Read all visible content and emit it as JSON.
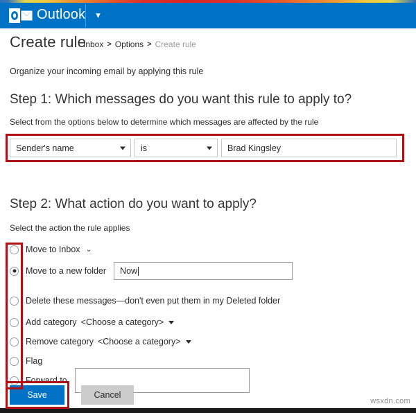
{
  "header": {
    "brand": "Outlook",
    "caret_icon": "chevron-down-icon"
  },
  "page": {
    "title": "Create rule",
    "intro": "Organize your incoming email by applying this rule",
    "breadcrumb": {
      "item1": "Inbox",
      "sep1": ">",
      "item2": "Options",
      "sep2": ">",
      "current": "Create rule"
    }
  },
  "step1": {
    "heading": "Step 1: Which messages do you want this rule to apply to?",
    "subtext": "Select from the options below to determine which messages are affected by the rule",
    "field_select": "Sender's name",
    "operator_select": "is",
    "value_input": "Brad Kingsley"
  },
  "step2": {
    "heading": "Step 2: What action do you want to apply?",
    "subtext": "Select the action the rule applies",
    "actions": [
      {
        "label": "Move to Inbox",
        "selected": false,
        "has_chevron": true
      },
      {
        "label": "Move to a new folder",
        "selected": true,
        "input_value": "Now"
      },
      {
        "label": "Delete these messages—don't even put them in my Deleted folder",
        "selected": false
      },
      {
        "label": "Add category",
        "selected": false,
        "suffix": "<Choose a category>",
        "has_triangle": true
      },
      {
        "label": "Remove category",
        "selected": false,
        "suffix": "<Choose a category>",
        "has_triangle": true
      },
      {
        "label": "Flag",
        "selected": false
      },
      {
        "label": "Forward to",
        "selected": false,
        "input_value": ""
      }
    ]
  },
  "footer": {
    "save_label": "Save",
    "cancel_label": "Cancel"
  },
  "watermark": "wsxdn.com",
  "colors": {
    "brand_blue": "#0072c6",
    "annotation_red": "#b01116",
    "cancel_gray": "#cccccc"
  }
}
